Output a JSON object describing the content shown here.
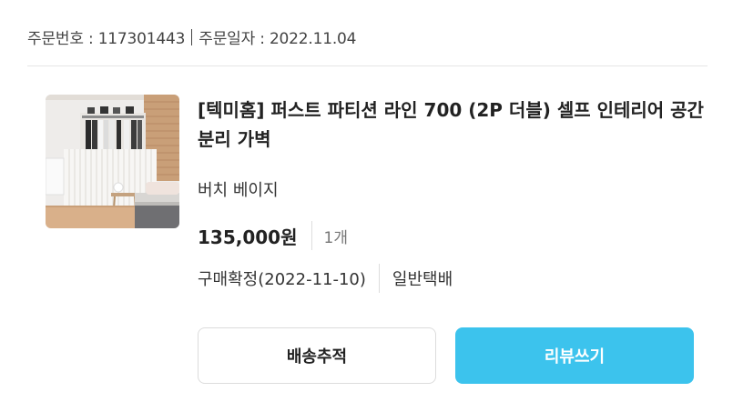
{
  "order": {
    "number_label": "주문번호 : 117301443",
    "date_label": "주문일자 : 2022.11.04"
  },
  "product": {
    "image_icon": "room-partition-photo",
    "title": "[텍미홈] 퍼스트 파티션 라인 700 (2P 더블) 셀프 인테리어 공간분리 가벽",
    "option": "버치 베이지",
    "price": "135,000원",
    "quantity": "1개",
    "status": "구매확정(2022-11-10)",
    "shipping": "일반택배"
  },
  "actions": {
    "track_label": "배송추적",
    "review_label": "리뷰쓰기"
  },
  "colors": {
    "accent": "#3cc3ed"
  }
}
